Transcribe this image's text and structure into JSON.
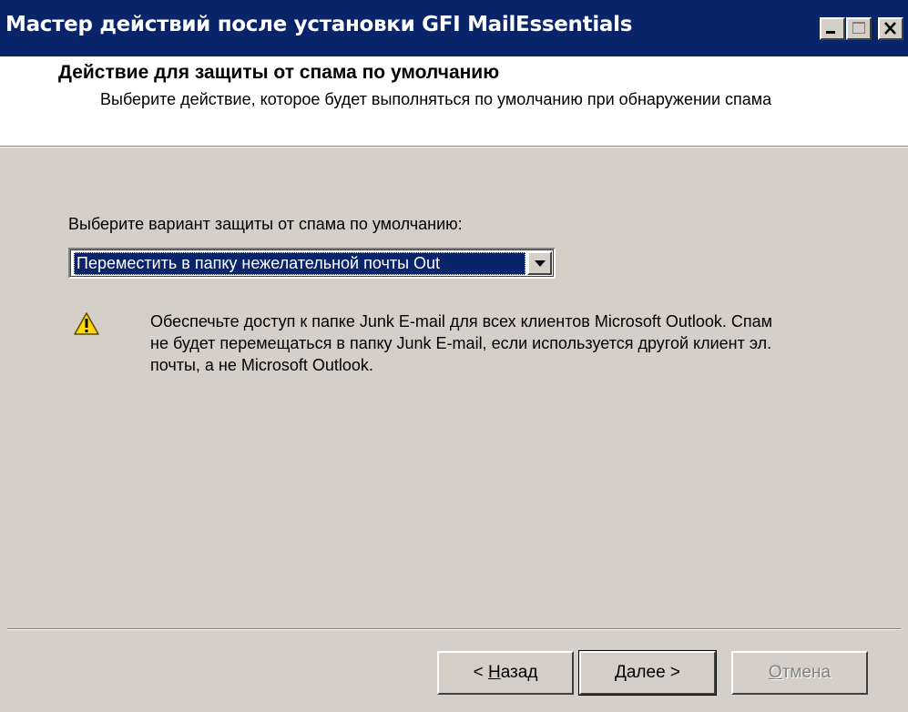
{
  "window": {
    "title": "Мастер действий после установки GFI MailEssentials"
  },
  "header": {
    "title": "Действие для защиты от спама по умолчанию",
    "subtitle": "Выберите действие, которое будет выполняться по умолчанию при обнаружении спама"
  },
  "main": {
    "prompt_label": "Выберите вариант защиты от спама по умолчанию:",
    "select_value": "Переместить в папку нежелательной почты Out",
    "warning_icon": "warning-triangle-icon",
    "warning_text": "Обеспечьте доступ к папке Junk E-mail для всех клиентов Microsoft Outlook. Спам не будет перемещаться в папку Junk E-mail, если используется другой клиент эл. почты, а не Microsoft Outlook."
  },
  "footer": {
    "back": {
      "prefix": "< ",
      "mnemonic": "Н",
      "rest": "азад"
    },
    "next": {
      "mnemonic": "Д",
      "rest": "алее",
      "suffix": " >"
    },
    "cancel": {
      "mnemonic": "О",
      "rest": "тмена"
    }
  },
  "colors": {
    "titlebar": "#0a246a",
    "face": "#d4d0c8",
    "selection": "#0a246a",
    "warning": "#ffd800"
  }
}
